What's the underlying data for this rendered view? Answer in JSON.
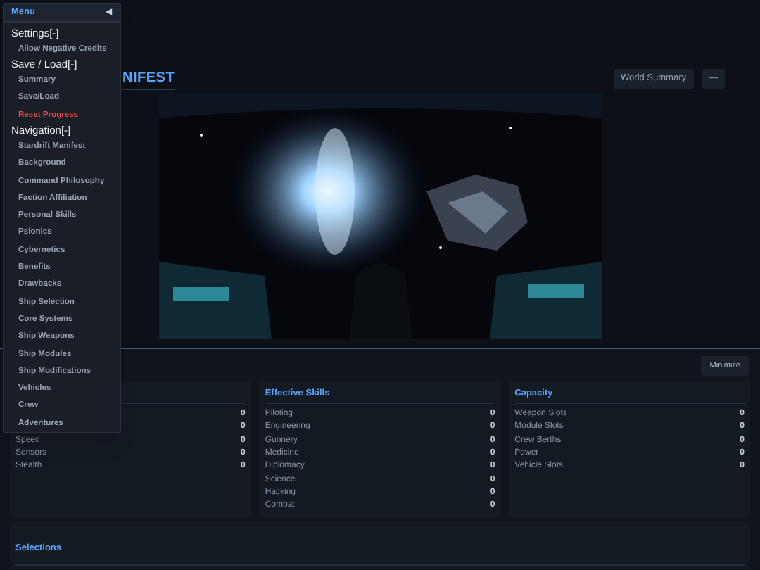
{
  "menu": {
    "title": "Menu",
    "collapse_icon": "◀",
    "sections": [
      {
        "label": "Settings[-]",
        "children": [
          {
            "label": "Allow Negative Credits",
            "kind": "normal"
          }
        ]
      },
      {
        "label": "Save / Load[-]",
        "children": [
          {
            "label": "Summary",
            "kind": "normal"
          },
          {
            "label": "Save/Load",
            "kind": "normal"
          },
          {
            "label": "Reset Progress",
            "kind": "danger"
          }
        ]
      },
      {
        "label": "Navigation[-]",
        "children": [
          {
            "label": "Stardrift Manifest",
            "kind": "normal"
          },
          {
            "label": "Background",
            "kind": "normal"
          },
          {
            "label": "Command Philosophy",
            "kind": "normal"
          },
          {
            "label": "Faction Affiliation",
            "kind": "normal"
          },
          {
            "label": "Personal Skills",
            "kind": "normal"
          },
          {
            "label": "Psionics",
            "kind": "normal"
          },
          {
            "label": "Cybernetics",
            "kind": "normal"
          },
          {
            "label": "Benefits",
            "kind": "normal"
          },
          {
            "label": "Drawbacks",
            "kind": "normal"
          },
          {
            "label": "Ship Selection",
            "kind": "normal"
          },
          {
            "label": "Core Systems",
            "kind": "normal"
          },
          {
            "label": "Ship Weapons",
            "kind": "normal"
          },
          {
            "label": "Ship Modules",
            "kind": "normal"
          },
          {
            "label": "Ship Modifications",
            "kind": "normal"
          },
          {
            "label": "Vehicles",
            "kind": "normal"
          },
          {
            "label": "Crew",
            "kind": "normal"
          },
          {
            "label": "Adventures",
            "kind": "normal"
          }
        ]
      }
    ]
  },
  "header": {
    "title": "NIFEST",
    "buttons": [
      "World Summary",
      "—"
    ]
  },
  "summary": {
    "minimize_button": "Minimize",
    "panels": [
      {
        "rows": [
          {
            "value": "0"
          },
          {
            "value": "0"
          },
          {
            "label": "Speed",
            "value": "0"
          },
          {
            "label": "Sensors",
            "value": "0"
          },
          {
            "label": "Stealth",
            "value": "0"
          }
        ]
      },
      {
        "title": "Effective Skills",
        "rows": [
          {
            "label": "Piloting",
            "value": "0"
          },
          {
            "label": "Engineering",
            "value": "0"
          },
          {
            "label": "Gunnery",
            "value": "0"
          },
          {
            "label": "Medicine",
            "value": "0"
          },
          {
            "label": "Diplomacy",
            "value": "0"
          },
          {
            "label": "Science",
            "value": "0"
          },
          {
            "label": "Hacking",
            "value": "0"
          },
          {
            "label": "Combat",
            "value": "0"
          }
        ]
      },
      {
        "title": "Capacity",
        "rows": [
          {
            "label": "Weapon Slots",
            "value": "0"
          },
          {
            "label": "Module Slots",
            "value": "0"
          },
          {
            "label": "Crew Berths",
            "value": "0"
          },
          {
            "label": "Power",
            "value": "0"
          },
          {
            "label": "Vehicle Slots",
            "value": "0"
          }
        ]
      }
    ],
    "selections_title": "Selections"
  }
}
